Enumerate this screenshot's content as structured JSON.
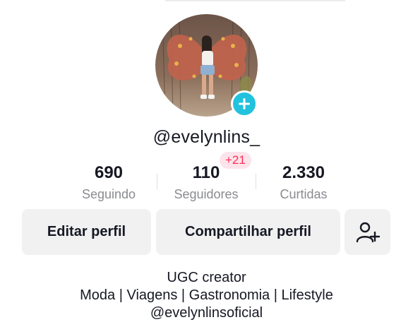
{
  "profile": {
    "username": "@evelynlins_",
    "avatar_icon": "profile-photo",
    "add_icon": "plus-icon"
  },
  "stats": {
    "following": {
      "value": "690",
      "label": "Seguindo"
    },
    "followers": {
      "value": "110",
      "label": "Seguidores",
      "increment": "+21"
    },
    "likes": {
      "value": "2.330",
      "label": "Curtidas"
    }
  },
  "actions": {
    "edit_label": "Editar perfil",
    "share_label": "Compartilhar perfil",
    "add_friend_icon": "add-user-icon"
  },
  "bio": {
    "line1": "UGC creator",
    "line2": "Moda | Viagens | Gastronomia | Lifestyle",
    "line3": "@evelynlinsoficial"
  },
  "colors": {
    "accent_cyan": "#21c2dd",
    "badge_pink": "#fe2c55",
    "button_bg": "#f1f1f2"
  }
}
